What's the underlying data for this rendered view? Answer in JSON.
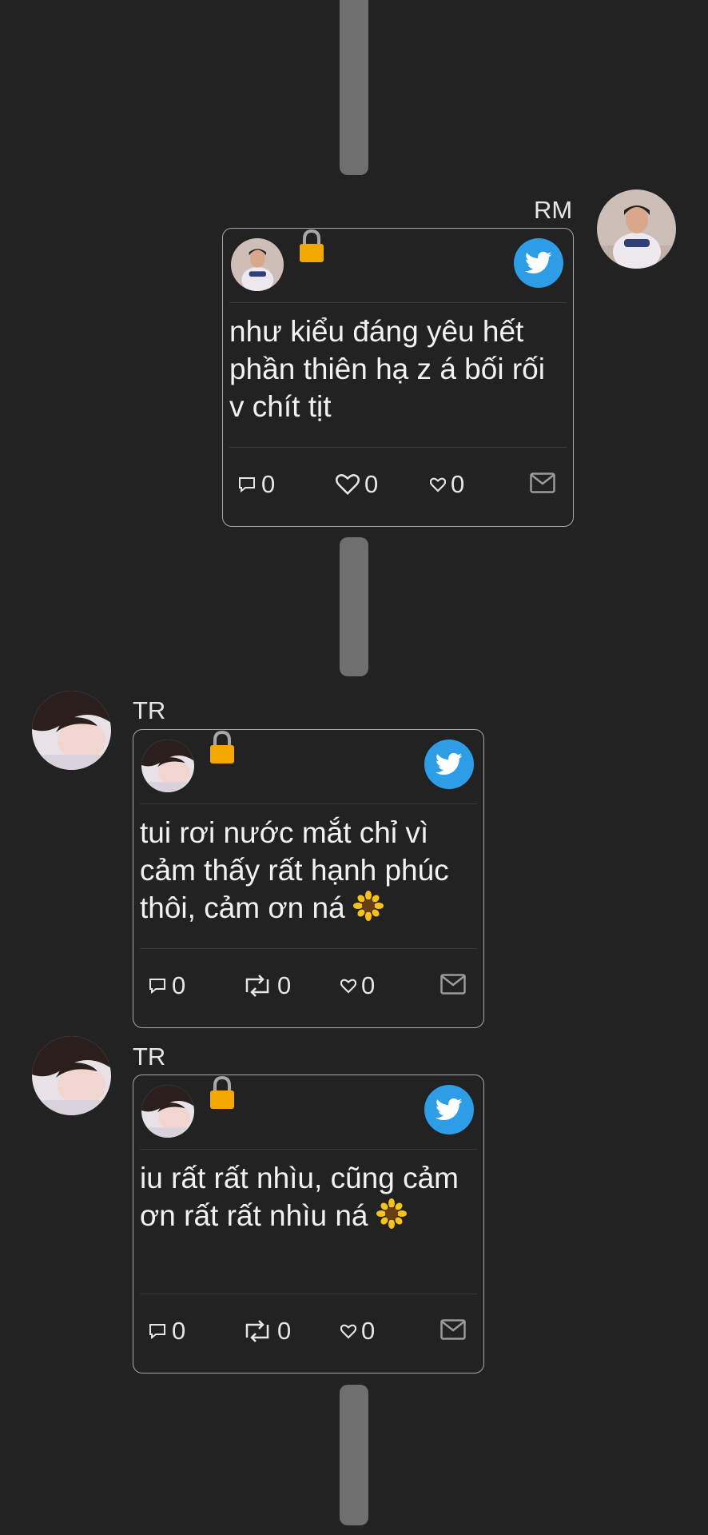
{
  "messages": [
    {
      "sender": "RM",
      "text": "như kiểu đáng yêu hết phần thiên hạ z á bối rối v chít tịt",
      "has_flower": false,
      "stats": {
        "comments": "0",
        "likes": "0",
        "hearts": "0"
      },
      "icons": [
        "speech-bubble-icon",
        "heart-icon",
        "small-heart-icon",
        "mail-icon"
      ]
    },
    {
      "sender": "TR",
      "text": "tui rơi nước mắt chỉ vì cảm thấy rất hạnh phúc thôi, cảm ơn ná",
      "has_flower": true,
      "stats": {
        "comments": "0",
        "retweets": "0",
        "likes": "0"
      },
      "icons": [
        "speech-bubble-icon",
        "retweet-icon",
        "small-heart-icon",
        "mail-icon"
      ]
    },
    {
      "sender": "TR",
      "text": "iu rất rất nhìu, cũng cảm ơn rất rất nhìu ná",
      "has_flower": true,
      "stats": {
        "comments": "0",
        "retweets": "0",
        "likes": "0"
      },
      "icons": [
        "speech-bubble-icon",
        "retweet-icon",
        "small-heart-icon",
        "mail-icon"
      ]
    }
  ],
  "colors": {
    "background": "#222222",
    "card_border": "#a8a8a8",
    "twitter_blue": "#2d9ee6",
    "lock_gold": "#f2a800",
    "divider": "#6f6f6f"
  }
}
